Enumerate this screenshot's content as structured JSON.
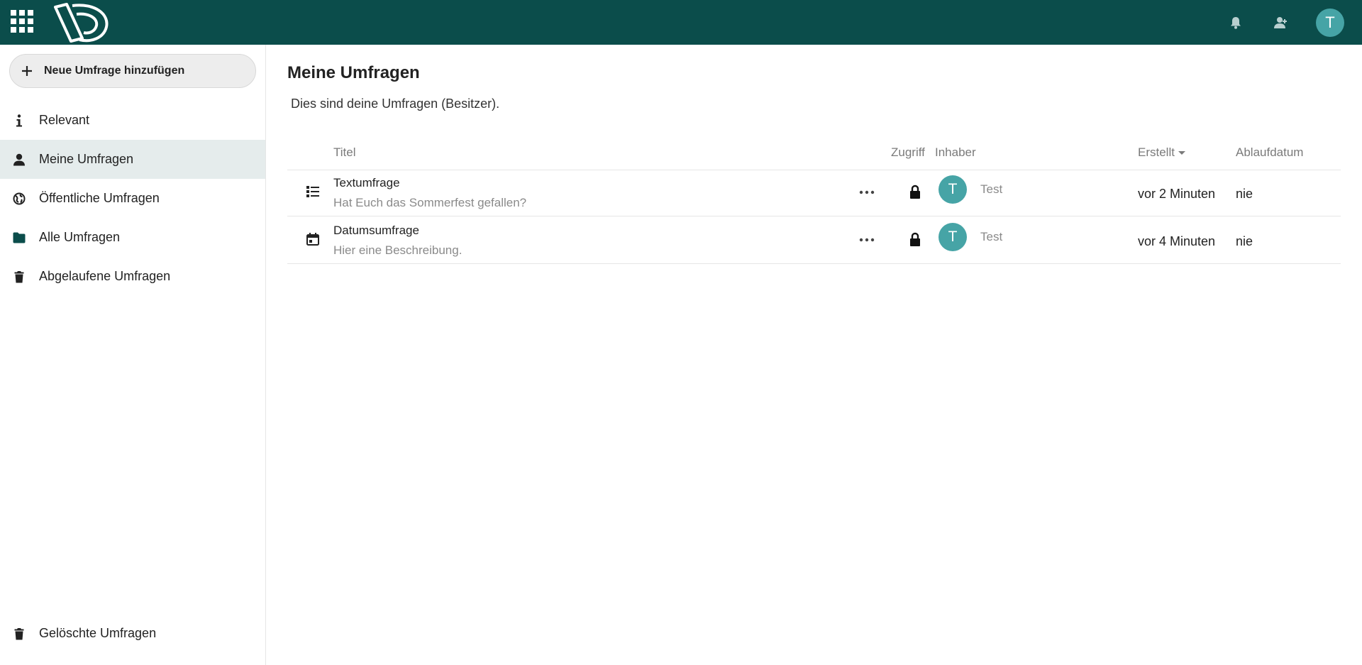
{
  "header": {
    "apps_icon": "apps-grid-icon",
    "logo": "polls-logo",
    "notifications_icon": "bell-icon",
    "contacts_icon": "contacts-icon",
    "user_avatar_letter": "T",
    "colors": {
      "bar": "#0b4d4b",
      "avatar": "#46a4a6"
    }
  },
  "sidebar": {
    "new_poll_label": "Neue Umfrage hinzufügen",
    "items": [
      {
        "label": "Relevant",
        "icon": "info-icon"
      },
      {
        "label": "Meine Umfragen",
        "icon": "user-icon",
        "active": true
      },
      {
        "label": "Öffentliche Umfragen",
        "icon": "globe-icon"
      },
      {
        "label": "Alle Umfragen",
        "icon": "folder-icon"
      },
      {
        "label": "Abgelaufene Umfragen",
        "icon": "trash-icon"
      }
    ],
    "bottom_item": {
      "label": "Gelöschte Umfragen",
      "icon": "trash-icon"
    }
  },
  "main": {
    "title": "Meine Umfragen",
    "description": "Dies sind deine Umfragen (Besitzer).",
    "columns": {
      "title": "Titel",
      "access": "Zugriff",
      "owner": "Inhaber",
      "created": "Erstellt",
      "expiry": "Ablaufdatum"
    },
    "rows": [
      {
        "type_icon": "text-poll-icon",
        "title": "Textumfrage",
        "description": "Hat Euch das Sommerfest gefallen?",
        "access_icon": "lock-icon",
        "owner_initial": "T",
        "owner": "Test",
        "created": "vor 2 Minuten",
        "expiry": "nie"
      },
      {
        "type_icon": "date-poll-icon",
        "title": "Datumsumfrage",
        "description": "Hier eine Beschreibung.",
        "access_icon": "lock-icon",
        "owner_initial": "T",
        "owner": "Test",
        "created": "vor 4 Minuten",
        "expiry": "nie"
      }
    ]
  }
}
